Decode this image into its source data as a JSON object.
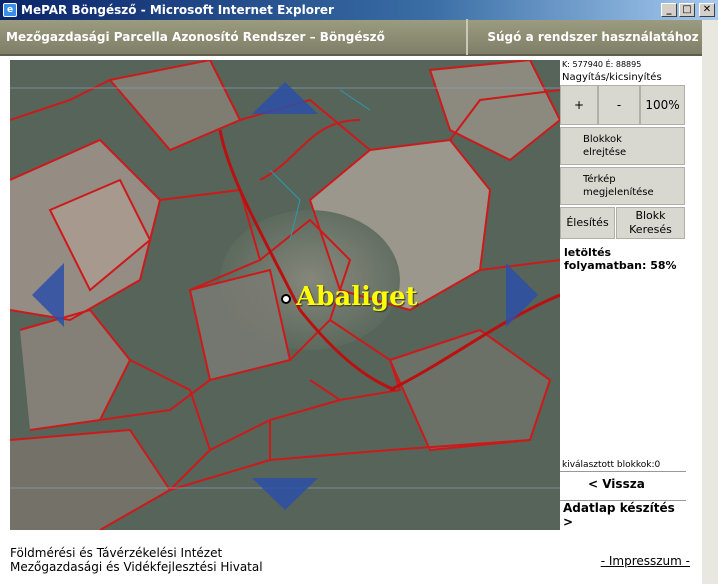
{
  "window": {
    "title": "MePAR Böngésző - Microsoft Internet Explorer",
    "app_icon_glyph": "e",
    "minimize_glyph": "_",
    "maximize_glyph": "□",
    "close_glyph": "✕"
  },
  "header": {
    "app_title": "Mezőgazdasági Parcella Azonosító Rendszer – Böngésző",
    "help_link": "Súgó a rendszer használatához"
  },
  "map": {
    "place_name": "Abaliget",
    "arrow_color": "#2d4fa8",
    "parcel_line_color": "#cc1a1a"
  },
  "panel": {
    "coords": "K: 577940    É: 88895",
    "zoom_label": "Nagyítás/kicsinyítés",
    "zoom_in": "+",
    "zoom_out": "-",
    "zoom_level": "100%",
    "hide_blocks_line1": "Blokkok",
    "hide_blocks_line2": "elrejtése",
    "show_map_line1": "Térkép",
    "show_map_line2": "megjelenítése",
    "activate": "Élesítés",
    "block_search_line1": "Blokk",
    "block_search_line2": "Keresés",
    "status_line1": "letöltés",
    "status_line2": "folyamatban: 58%",
    "download_progress_percent": 58,
    "selected_blocks": "kiválasztott blokkok:0",
    "back": "<  Vissza",
    "datasheet": "Adatlap készítés >"
  },
  "footer": {
    "org_line1": "Földmérési és Távérzékelési Intézet",
    "org_line2": "Mezőgazdasági és Vidékfejlesztési Hivatal",
    "impressum": "- Impresszum -"
  }
}
